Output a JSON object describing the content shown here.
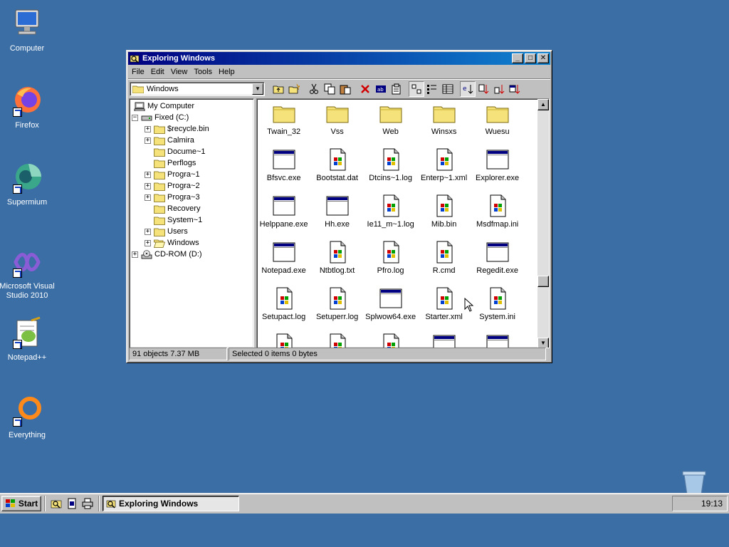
{
  "desktop": {
    "icons": [
      {
        "label": "Computer"
      },
      {
        "label": "Firefox"
      },
      {
        "label": "Supermium"
      },
      {
        "label": "Microsoft Visual Studio 2010"
      },
      {
        "label": "Notepad++"
      },
      {
        "label": "Everything"
      }
    ]
  },
  "window": {
    "title": "Exploring Windows",
    "buttons": {
      "minimize": "_",
      "maximize": "□",
      "close": "✕"
    },
    "menu": [
      "File",
      "Edit",
      "View",
      "Tools",
      "Help"
    ],
    "address": "Windows",
    "tree": [
      {
        "label": "My Computer",
        "icon": "computer-icon",
        "expander": ""
      },
      {
        "label": "Fixed (C:)",
        "icon": "drive-icon",
        "expander": "−"
      },
      {
        "label": "$recycle.bin",
        "icon": "folder-icon",
        "expander": "+"
      },
      {
        "label": "Calmira",
        "icon": "folder-icon",
        "expander": "+"
      },
      {
        "label": "Docume~1",
        "icon": "folder-icon",
        "expander": ""
      },
      {
        "label": "Perflogs",
        "icon": "folder-icon",
        "expander": ""
      },
      {
        "label": "Progra~1",
        "icon": "folder-icon",
        "expander": "+"
      },
      {
        "label": "Progra~2",
        "icon": "folder-icon",
        "expander": "+"
      },
      {
        "label": "Progra~3",
        "icon": "folder-icon",
        "expander": "+"
      },
      {
        "label": "Recovery",
        "icon": "folder-icon",
        "expander": ""
      },
      {
        "label": "System~1",
        "icon": "folder-icon",
        "expander": ""
      },
      {
        "label": "Users",
        "icon": "folder-icon",
        "expander": "+"
      },
      {
        "label": "Windows",
        "icon": "open-folder-icon",
        "expander": "+"
      },
      {
        "label": "CD-ROM (D:)",
        "icon": "cdrom-icon",
        "expander": "+"
      }
    ],
    "files": [
      {
        "name": "Twain_32",
        "type": "folder"
      },
      {
        "name": "Vss",
        "type": "folder"
      },
      {
        "name": "Web",
        "type": "folder"
      },
      {
        "name": "Winsxs",
        "type": "folder"
      },
      {
        "name": "Wuesu",
        "type": "folder"
      },
      {
        "name": "Bfsvc.exe",
        "type": "exe"
      },
      {
        "name": "Bootstat.dat",
        "type": "doc"
      },
      {
        "name": "Dtcins~1.log",
        "type": "doc"
      },
      {
        "name": "Enterp~1.xml",
        "type": "doc"
      },
      {
        "name": "Explorer.exe",
        "type": "exe"
      },
      {
        "name": "Helppane.exe",
        "type": "exe"
      },
      {
        "name": "Hh.exe",
        "type": "exe"
      },
      {
        "name": "Ie11_m~1.log",
        "type": "doc"
      },
      {
        "name": "Mib.bin",
        "type": "doc"
      },
      {
        "name": "Msdfmap.ini",
        "type": "doc"
      },
      {
        "name": "Notepad.exe",
        "type": "exe"
      },
      {
        "name": "Ntbtlog.txt",
        "type": "doc"
      },
      {
        "name": "Pfro.log",
        "type": "doc"
      },
      {
        "name": "R.cmd",
        "type": "doc"
      },
      {
        "name": "Regedit.exe",
        "type": "exe"
      },
      {
        "name": "Setupact.log",
        "type": "doc"
      },
      {
        "name": "Setuperr.log",
        "type": "doc"
      },
      {
        "name": "Splwow64.exe",
        "type": "exe"
      },
      {
        "name": "Starter.xml",
        "type": "doc"
      },
      {
        "name": "System.ini",
        "type": "doc"
      },
      {
        "name": "",
        "type": "doc"
      },
      {
        "name": "",
        "type": "doc"
      },
      {
        "name": "",
        "type": "doc"
      },
      {
        "name": "",
        "type": "exe"
      },
      {
        "name": "",
        "type": "exe"
      }
    ],
    "status": {
      "objects": "91 objects  7.37 MB",
      "selected": "Selected 0 items  0 bytes"
    }
  },
  "taskbar": {
    "start_label": "Start",
    "task_label": "Exploring Windows",
    "clock": "19:13"
  },
  "colors": {
    "desktop": "#3a6ea5",
    "title_active": "#000080",
    "folder": "#f5e27a"
  }
}
